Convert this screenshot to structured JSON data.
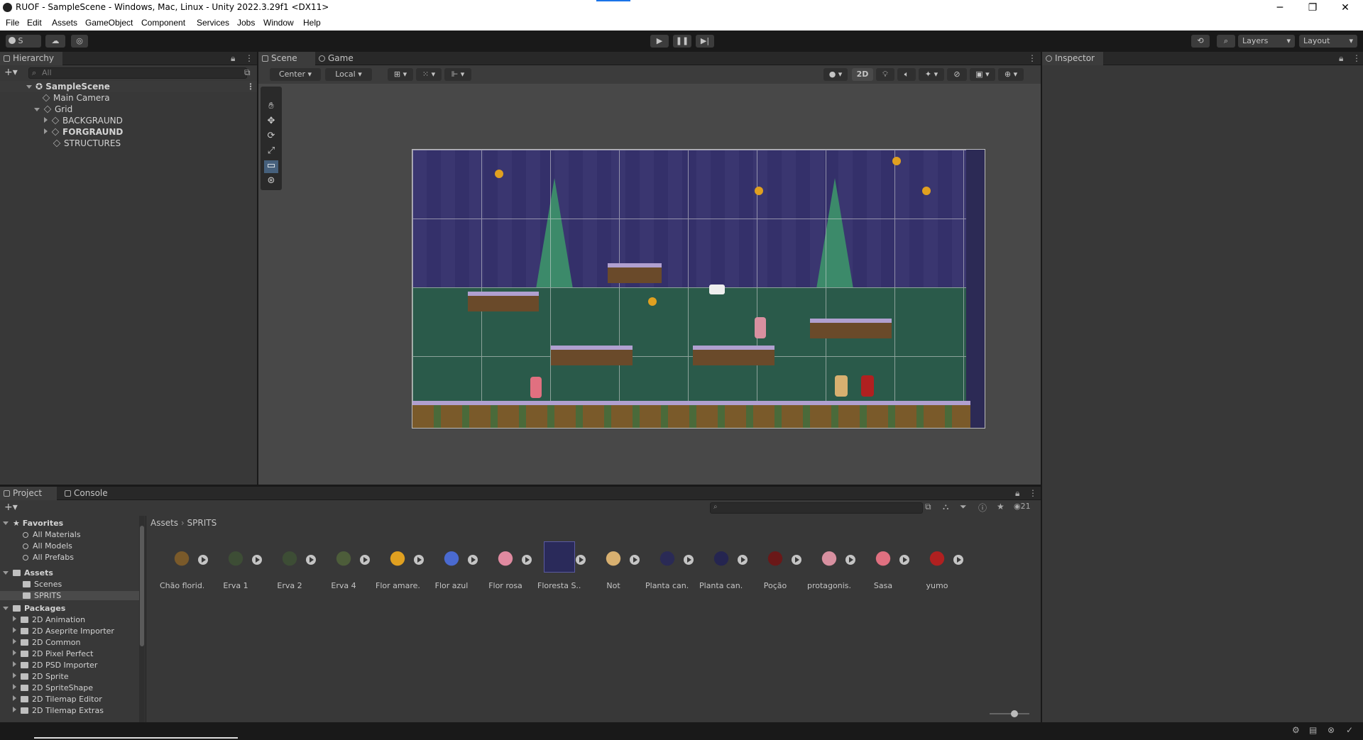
{
  "window": {
    "title": "RUOF - SampleScene - Windows, Mac, Linux - Unity 2022.3.29f1 <DX11>",
    "minimize": "─",
    "maximize": "❐",
    "close": "✕"
  },
  "menu": [
    "File",
    "Edit",
    "Assets",
    "GameObject",
    "Component",
    "Services",
    "Jobs",
    "Window",
    "Help"
  ],
  "toolbar": {
    "account_label": "S",
    "layers_label": "Layers",
    "layout_label": "Layout"
  },
  "hierarchy": {
    "tab": "Hierarchy",
    "search_placeholder": "All",
    "scene": "SampleScene",
    "items": [
      {
        "label": "Main Camera"
      },
      {
        "label": "Grid"
      },
      {
        "label": "BACKGRAUND"
      },
      {
        "label": "FORGRAUND"
      },
      {
        "label": "STRUCTURES"
      }
    ]
  },
  "scene": {
    "tabs": [
      "Scene",
      "Game"
    ],
    "pivot": "Center",
    "space": "Local",
    "mode_2d": "2D"
  },
  "inspector": {
    "tab": "Inspector"
  },
  "project": {
    "tabs": [
      "Project",
      "Console"
    ],
    "count": "21",
    "breadcrumb": [
      "Assets",
      "SPRITS"
    ],
    "favorites_label": "Favorites",
    "favorites": [
      "All Materials",
      "All Models",
      "All Prefabs"
    ],
    "assets_label": "Assets",
    "asset_folders": [
      "Scenes",
      "SPRITS"
    ],
    "packages_label": "Packages",
    "packages": [
      "2D Animation",
      "2D Aseprite Importer",
      "2D Common",
      "2D Pixel Perfect",
      "2D PSD Importer",
      "2D Sprite",
      "2D SpriteShape",
      "2D Tilemap Editor",
      "2D Tilemap Extras"
    ],
    "assets": [
      {
        "label": "Chão florid...",
        "color": "#7a5a2a"
      },
      {
        "label": "Erva 1",
        "color": "#3d4d35"
      },
      {
        "label": "Erva 2",
        "color": "#3d4d35"
      },
      {
        "label": "Erva 4",
        "color": "#4d5d3a"
      },
      {
        "label": "Flor amare...",
        "color": "#e0a020"
      },
      {
        "label": "Flor azul",
        "color": "#4a6ad0"
      },
      {
        "label": "Flor rosa",
        "color": "#e08aa0"
      },
      {
        "label": "Floresta S...",
        "color": "#2a2a5a"
      },
      {
        "label": "Not",
        "color": "#d8b070"
      },
      {
        "label": "Planta can...",
        "color": "#2a2a55"
      },
      {
        "label": "Planta can...",
        "color": "#252550"
      },
      {
        "label": "Poção",
        "color": "#6a1818"
      },
      {
        "label": "protagonis...",
        "color": "#d890a0"
      },
      {
        "label": "Sasa",
        "color": "#e07080"
      },
      {
        "label": "yumo",
        "color": "#b02020"
      }
    ]
  }
}
